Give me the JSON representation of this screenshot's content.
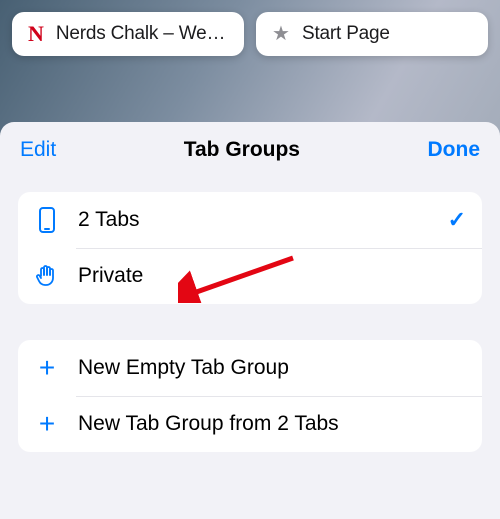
{
  "tabs": [
    {
      "favicon": "N",
      "title": "Nerds Chalk – We Ex..."
    },
    {
      "favicon": "star",
      "title": "Start Page"
    }
  ],
  "sheet": {
    "edit": "Edit",
    "title": "Tab Groups",
    "done": "Done"
  },
  "groups": [
    {
      "icon": "phone",
      "label": "2 Tabs",
      "selected": true
    },
    {
      "icon": "hand",
      "label": "Private",
      "selected": false
    }
  ],
  "actions": [
    {
      "icon": "plus",
      "label": "New Empty Tab Group"
    },
    {
      "icon": "plus",
      "label": "New Tab Group from 2 Tabs"
    }
  ]
}
